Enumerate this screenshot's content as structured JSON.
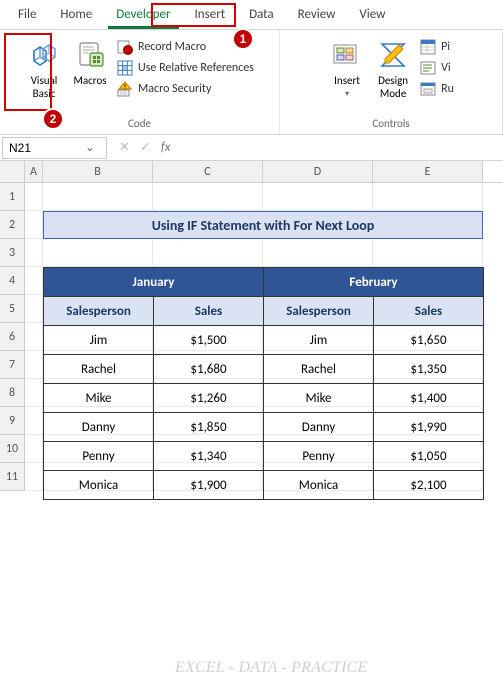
{
  "tabs": {
    "file": "File",
    "home": "Home",
    "developer": "Developer",
    "insert": "Insert",
    "data": "Data",
    "review": "Review",
    "view": "View"
  },
  "ribbon": {
    "code": {
      "visual_basic": "Visual\nBasic",
      "macros": "Macros",
      "record_macro": "Record Macro",
      "use_relative": "Use Relative References",
      "macro_security": "Macro Security",
      "group_label": "Code"
    },
    "controls": {
      "insert": "Insert",
      "design_mode": "Design\nMode",
      "properties": "Pi",
      "view_code": "Vi",
      "run_dialog": "Ru",
      "group_label": "Controls"
    }
  },
  "badges": {
    "one": "1",
    "two": "2"
  },
  "namebox": "N21",
  "fx_label": "fx",
  "columns": {
    "a": "A",
    "b": "B",
    "c": "C",
    "d": "D",
    "e": "E"
  },
  "rows": [
    "1",
    "2",
    "3",
    "4",
    "5",
    "6",
    "7",
    "8",
    "9",
    "10",
    "11"
  ],
  "title": "Using IF Statement with For Next Loop",
  "months": {
    "jan": "January",
    "feb": "February"
  },
  "sub": {
    "sp": "Salesperson",
    "sl": "Sales"
  },
  "chart_data": {
    "type": "table",
    "months": [
      "January",
      "February"
    ],
    "columns": [
      "Salesperson",
      "Sales"
    ],
    "data": [
      {
        "jan_sp": "Jim",
        "jan_sl": "$1,500",
        "feb_sp": "Jim",
        "feb_sl": "$1,650"
      },
      {
        "jan_sp": "Rachel",
        "jan_sl": "$1,680",
        "feb_sp": "Rachel",
        "feb_sl": "$1,350"
      },
      {
        "jan_sp": "Mike",
        "jan_sl": "$1,260",
        "feb_sp": "Mike",
        "feb_sl": "$1,400"
      },
      {
        "jan_sp": "Danny",
        "jan_sl": "$1,850",
        "feb_sp": "Danny",
        "feb_sl": "$1,990"
      },
      {
        "jan_sp": "Penny",
        "jan_sl": "$1,340",
        "feb_sp": "Penny",
        "feb_sl": "$1,050"
      },
      {
        "jan_sp": "Monica",
        "jan_sl": "$1,900",
        "feb_sp": "Monica",
        "feb_sl": "$2,100"
      }
    ]
  },
  "watermark": "EXCEL - DATA - PRACTICE"
}
